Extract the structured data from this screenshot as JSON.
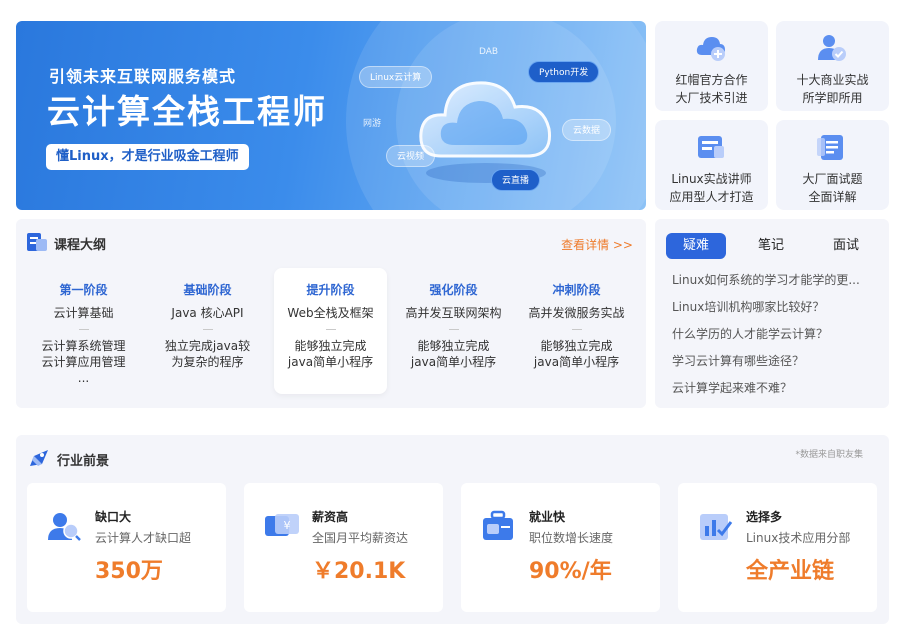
{
  "banner": {
    "subtitle": "引领未来互联网服务模式",
    "title": "云计算全栈工程师",
    "pill": "懂Linux，才是行业吸金工程师",
    "tags": [
      "DAB",
      "Linux云计算",
      "Python开发",
      "网游",
      "云数据",
      "云视频",
      "云直播"
    ]
  },
  "features": [
    {
      "line1": "红帽官方合作",
      "line2": "大厂技术引进",
      "icon": "cloud-plus-icon"
    },
    {
      "line1": "十大商业实战",
      "line2": "所学即所用",
      "icon": "user-check-icon"
    },
    {
      "line1": "Linux实战讲师",
      "line2": "应用型人才打造",
      "icon": "id-card-icon"
    },
    {
      "line1": "大厂面试题",
      "line2": "全面详解",
      "icon": "document-list-icon"
    }
  ],
  "outline": {
    "title": "课程大纲",
    "more": "查看详情 >>",
    "stages": [
      {
        "name": "第一阶段",
        "sub": "云计算基础",
        "desc1": "云计算系统管理",
        "desc2": "云计算应用管理",
        "desc3": "..."
      },
      {
        "name": "基础阶段",
        "sub": "Java 核心API",
        "desc1": "独立完成java较",
        "desc2": "为复杂的程序",
        "desc3": ""
      },
      {
        "name": "提升阶段",
        "sub": "Web全栈及框架",
        "desc1": "能够独立完成",
        "desc2": "java简单小程序",
        "desc3": ""
      },
      {
        "name": "强化阶段",
        "sub": "高并发互联网架构",
        "desc1": "能够独立完成",
        "desc2": "java简单小程序",
        "desc3": ""
      },
      {
        "name": "冲刺阶段",
        "sub": "高并发微服务实战",
        "desc1": "能够独立完成",
        "desc2": "java简单小程序",
        "desc3": ""
      }
    ]
  },
  "faq": {
    "tabs": [
      "疑难",
      "笔记",
      "面试"
    ],
    "questions": [
      "Linux如何系统的学习才能学的更...",
      "Linux培训机构哪家比较好？",
      "什么学历的人才能学云计算？",
      "学习云计算有哪些途径？",
      "云计算学起来难不难？"
    ]
  },
  "industry": {
    "title": "行业前景",
    "source": "*数据来自职友集",
    "stats": [
      {
        "title": "缺口大",
        "desc": "云计算人才缺口超",
        "value": "350万",
        "icon": "search-person-icon"
      },
      {
        "title": "薪资高",
        "desc": "全国月平均薪资达",
        "value": "￥20.1K",
        "icon": "yen-card-icon"
      },
      {
        "title": "就业快",
        "desc": "职位数增长速度",
        "value": "90%/年",
        "icon": "briefcase-icon"
      },
      {
        "title": "选择多",
        "desc": "Linux技术应用分部",
        "value": "全产业链",
        "icon": "chart-check-icon"
      }
    ]
  },
  "colors": {
    "primary": "#2d66dc",
    "accent": "#ef7c2b",
    "panel": "#f4f5fa"
  }
}
